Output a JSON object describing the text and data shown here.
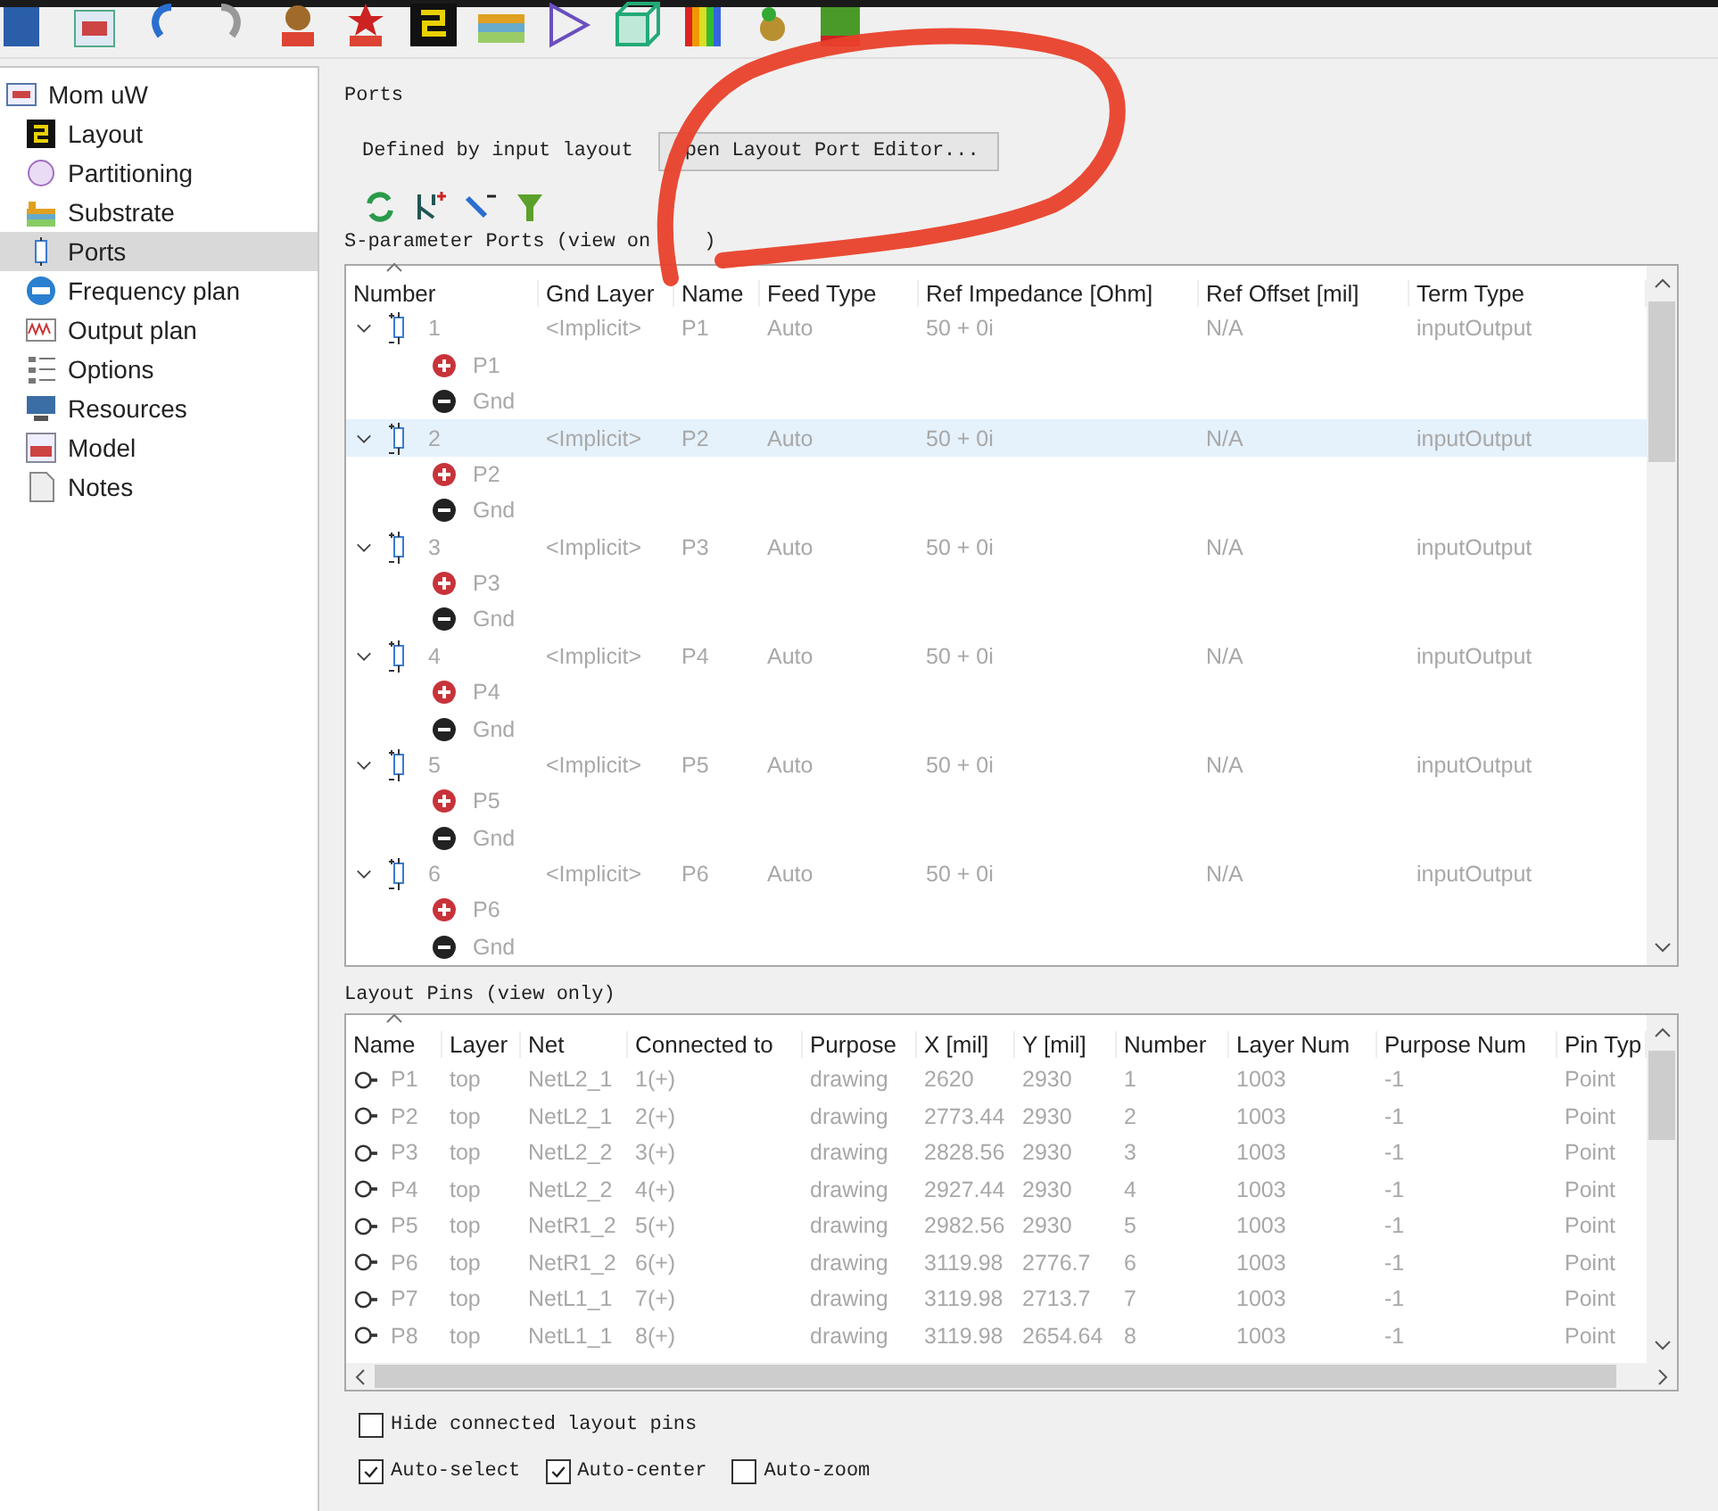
{
  "sidebar": {
    "root": "Mom uW",
    "items": [
      {
        "kind": "layout",
        "label": "Layout",
        "selected": false
      },
      {
        "kind": "partitioning",
        "label": "Partitioning",
        "selected": false
      },
      {
        "kind": "substrate",
        "label": "Substrate",
        "selected": false
      },
      {
        "kind": "ports",
        "label": "Ports",
        "selected": true
      },
      {
        "kind": "frequency",
        "label": "Frequency plan",
        "selected": false
      },
      {
        "kind": "output",
        "label": "Output plan",
        "selected": false
      },
      {
        "kind": "options",
        "label": "Options",
        "selected": false
      },
      {
        "kind": "resources",
        "label": "Resources",
        "selected": false
      },
      {
        "kind": "model",
        "label": "Model",
        "selected": false
      },
      {
        "kind": "notes",
        "label": "Notes",
        "selected": false
      }
    ]
  },
  "ports_group": {
    "title": "Ports",
    "defined_label": "Defined by input layout",
    "editor_button": "pen Layout Port Editor...",
    "sparam_label": "S-parameter Ports (view on",
    "sparam_label_end": ")"
  },
  "port_table": {
    "columns": [
      "Number",
      "Gnd Layer",
      "Name",
      "Feed Type",
      "Ref Impedance [Ohm]",
      "Ref Offset [mil]",
      "Term Type"
    ],
    "rows": [
      {
        "number": "1",
        "gnd_layer": "<Implicit>",
        "name": "P1",
        "feed_type": "Auto",
        "ref_impedance": "50 + 0i",
        "ref_offset": "N/A",
        "term_type": "inputOutput",
        "expanded": true,
        "selected": false,
        "children": [
          {
            "kind": "plus",
            "label": "P1"
          },
          {
            "kind": "minus",
            "label": "Gnd"
          }
        ]
      },
      {
        "number": "2",
        "gnd_layer": "<Implicit>",
        "name": "P2",
        "feed_type": "Auto",
        "ref_impedance": "50 + 0i",
        "ref_offset": "N/A",
        "term_type": "inputOutput",
        "expanded": true,
        "selected": true,
        "children": [
          {
            "kind": "plus",
            "label": "P2"
          },
          {
            "kind": "minus",
            "label": "Gnd"
          }
        ]
      },
      {
        "number": "3",
        "gnd_layer": "<Implicit>",
        "name": "P3",
        "feed_type": "Auto",
        "ref_impedance": "50 + 0i",
        "ref_offset": "N/A",
        "term_type": "inputOutput",
        "expanded": true,
        "selected": false,
        "children": [
          {
            "kind": "plus",
            "label": "P3"
          },
          {
            "kind": "minus",
            "label": "Gnd"
          }
        ]
      },
      {
        "number": "4",
        "gnd_layer": "<Implicit>",
        "name": "P4",
        "feed_type": "Auto",
        "ref_impedance": "50 + 0i",
        "ref_offset": "N/A",
        "term_type": "inputOutput",
        "expanded": true,
        "selected": false,
        "children": [
          {
            "kind": "plus",
            "label": "P4"
          },
          {
            "kind": "minus",
            "label": "Gnd"
          }
        ]
      },
      {
        "number": "5",
        "gnd_layer": "<Implicit>",
        "name": "P5",
        "feed_type": "Auto",
        "ref_impedance": "50 + 0i",
        "ref_offset": "N/A",
        "term_type": "inputOutput",
        "expanded": true,
        "selected": false,
        "children": [
          {
            "kind": "plus",
            "label": "P5"
          },
          {
            "kind": "minus",
            "label": "Gnd"
          }
        ]
      },
      {
        "number": "6",
        "gnd_layer": "<Implicit>",
        "name": "P6",
        "feed_type": "Auto",
        "ref_impedance": "50 + 0i",
        "ref_offset": "N/A",
        "term_type": "inputOutput",
        "expanded": true,
        "selected": false,
        "children": [
          {
            "kind": "plus",
            "label": "P6"
          },
          {
            "kind": "minus",
            "label": "Gnd"
          }
        ]
      }
    ]
  },
  "pins_table": {
    "title": "Layout Pins (view only)",
    "columns": [
      "Name",
      "Layer",
      "Net",
      "Connected to",
      "Purpose",
      "X [mil]",
      "Y [mil]",
      "Number",
      "Layer Num",
      "Purpose Num",
      "Pin Typ"
    ],
    "rows": [
      [
        "P1",
        "top",
        "NetL2_1",
        "1(+)",
        "drawing",
        "2620",
        "2930",
        "1",
        "1003",
        "-1",
        "Point"
      ],
      [
        "P2",
        "top",
        "NetL2_1",
        "2(+)",
        "drawing",
        "2773.44",
        "2930",
        "2",
        "1003",
        "-1",
        "Point"
      ],
      [
        "P3",
        "top",
        "NetL2_2",
        "3(+)",
        "drawing",
        "2828.56",
        "2930",
        "3",
        "1003",
        "-1",
        "Point"
      ],
      [
        "P4",
        "top",
        "NetL2_2",
        "4(+)",
        "drawing",
        "2927.44",
        "2930",
        "4",
        "1003",
        "-1",
        "Point"
      ],
      [
        "P5",
        "top",
        "NetR1_2",
        "5(+)",
        "drawing",
        "2982.56",
        "2930",
        "5",
        "1003",
        "-1",
        "Point"
      ],
      [
        "P6",
        "top",
        "NetR1_2",
        "6(+)",
        "drawing",
        "3119.98",
        "2776.7",
        "6",
        "1003",
        "-1",
        "Point"
      ],
      [
        "P7",
        "top",
        "NetL1_1",
        "7(+)",
        "drawing",
        "3119.98",
        "2713.7",
        "7",
        "1003",
        "-1",
        "Point"
      ],
      [
        "P8",
        "top",
        "NetL1_1",
        "8(+)",
        "drawing",
        "3119.98",
        "2654.64",
        "8",
        "1003",
        "-1",
        "Point"
      ]
    ]
  },
  "hide_pins": {
    "label": "Hide connected layout pins",
    "checked": false
  },
  "auto_options": [
    {
      "label": "Auto-select",
      "checked": true
    },
    {
      "label": "Auto-center",
      "checked": true
    },
    {
      "label": "Auto-zoom",
      "checked": false
    }
  ]
}
